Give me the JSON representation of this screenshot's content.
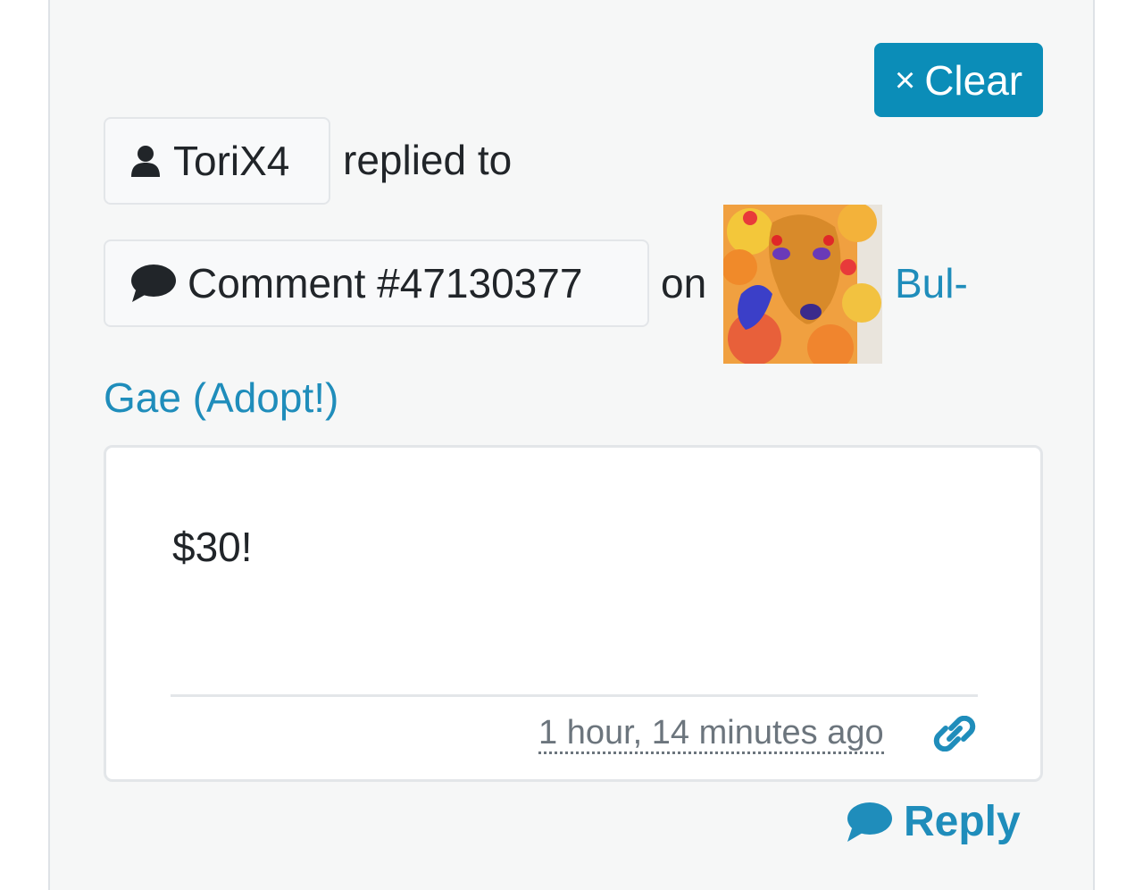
{
  "toolbar": {
    "clear_label": "Clear",
    "clear_icon": "×"
  },
  "notification": {
    "user": {
      "name": "ToriX4",
      "icon": "user-icon"
    },
    "replied_text": "replied to",
    "comment": {
      "label": "Comment #47130377",
      "icon": "comment-icon"
    },
    "on_text": "on",
    "post": {
      "title_part1": "Bul-",
      "title_part2": "Gae (Adopt!)"
    }
  },
  "comment_box": {
    "text": "$30!",
    "timestamp": "1 hour, 14 minutes ago",
    "permalink_icon": "link-icon"
  },
  "reply": {
    "label": "Reply",
    "icon": "comment-icon"
  },
  "colors": {
    "accent": "#0b8db8",
    "link": "#1f8dbb",
    "card_background": "#f6f7f7",
    "text": "#212529",
    "muted": "#6c757d"
  }
}
